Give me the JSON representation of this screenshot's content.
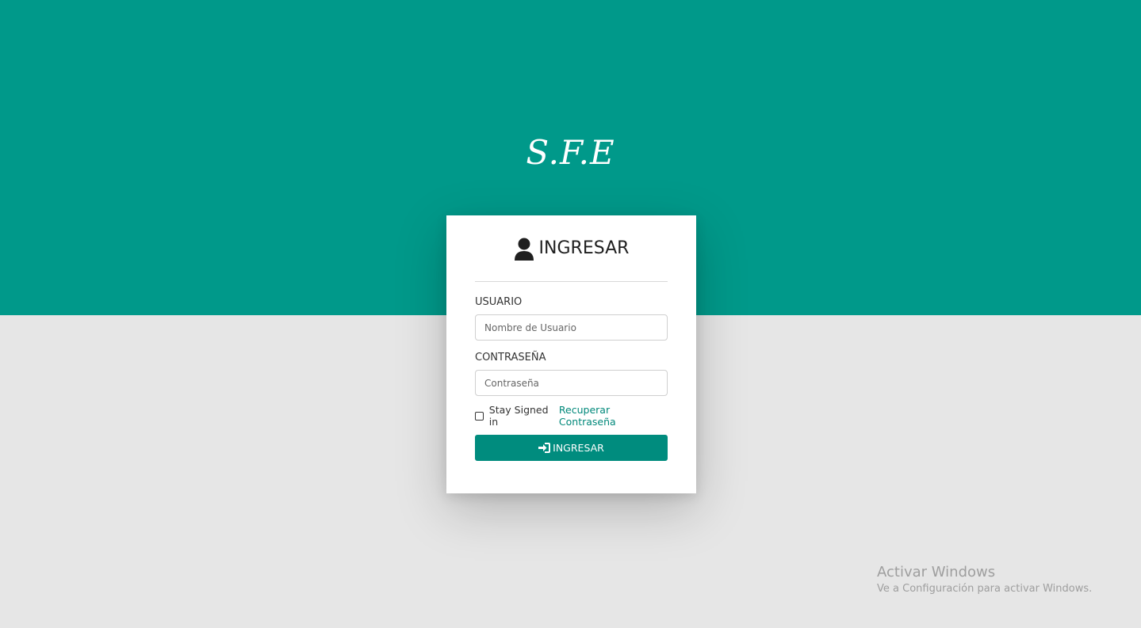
{
  "brand": {
    "title": "S.F.E",
    "teal": "#00998a"
  },
  "login": {
    "title": "INGRESAR",
    "header_icon": "user-icon",
    "username_label": "USUARIO",
    "username_placeholder": "Nombre de Usuario",
    "password_label": "CONTRASEÑA",
    "password_placeholder": "Contraseña",
    "stay_signed_in_label": "Stay Signed in",
    "stay_signed_in_checked": false,
    "recover_link": "Recuperar Contraseña",
    "submit_label": "INGRESAR",
    "submit_icon": "sign-in-icon",
    "button_color": "#008c7e"
  },
  "watermark": {
    "title": "Activar Windows",
    "subtitle": "Ve a Configuración para activar Windows."
  }
}
